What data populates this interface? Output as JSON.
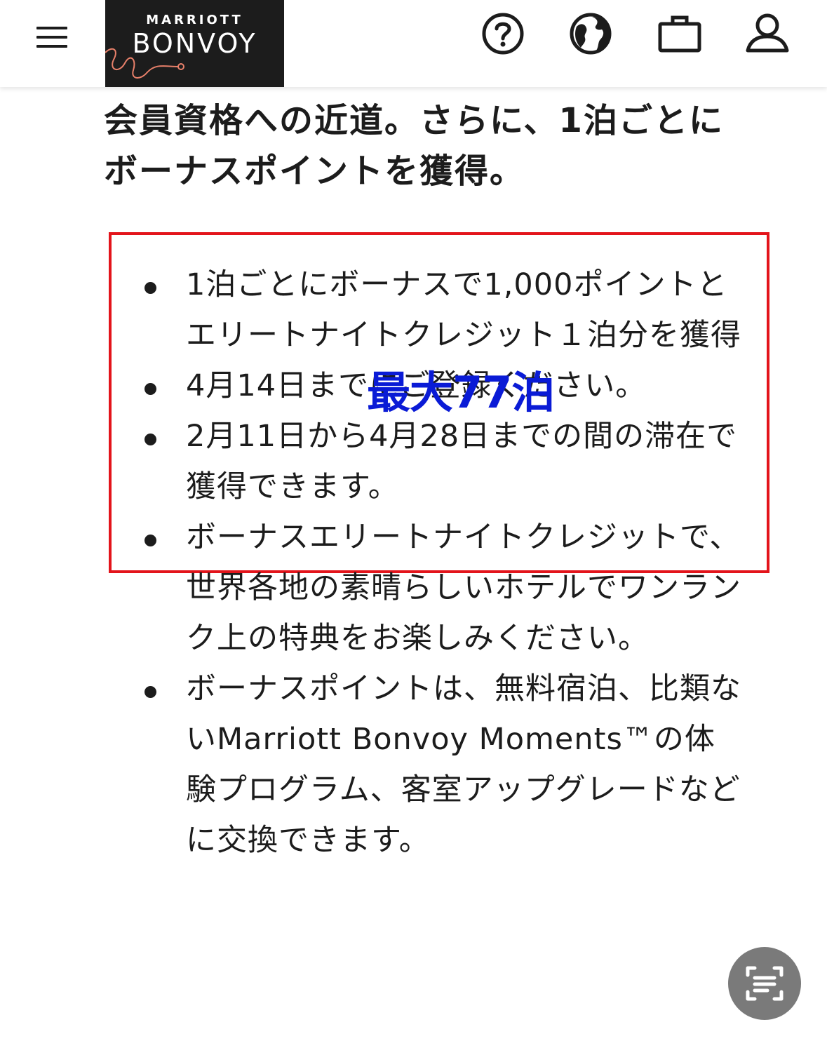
{
  "header": {
    "logo_top": "MARRIOTT",
    "logo_main": "BONVOY",
    "icons": [
      "menu-icon",
      "question-circle-icon",
      "globe-icon",
      "briefcase-icon",
      "user-icon"
    ],
    "logo_accent_color": "#e8806a"
  },
  "heading": "会員資格への近道。さらに、1泊ごとにボーナスポイントを獲得。",
  "highlight_color": "#e3141b",
  "annotation": {
    "text": "最大77泊",
    "color": "#0a1bd6"
  },
  "bullets": [
    "1泊ごとにボーナスで1,000ポイントとエリートナイトクレジット１泊分を獲得",
    "4月14日までにご登録ください。",
    "2月11日から4月28日までの間の滞在で獲得できます。",
    "ボーナスエリートナイトクレジットで、世界各地の素晴らしいホテルでワンランク上の特典をお楽しみください。",
    "ボーナスポイントは、無料宿泊、比類ないMarriott Bonvoy Moments™の体験プログラム、客室アップグレードなどに交換できます。"
  ],
  "floating_button_icon": "scan-text-icon"
}
